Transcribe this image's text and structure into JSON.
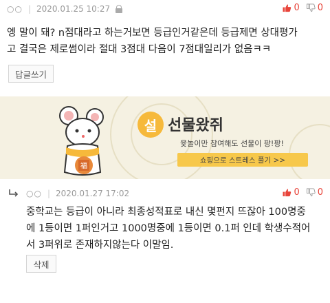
{
  "comment": {
    "author": "○○",
    "date": "2020.01.25 10:27",
    "upvotes": "0",
    "downvotes": "0",
    "text_line1": "엥 말이 돼? n점대라고 하는거보면 등급인거같은데 등급제면 상대평가",
    "text_line2": "고 결국은 제로썸이라 절대 3점대 다음이 7점대일리가 없음ㅋㅋ",
    "reply_button": "답글쓰기"
  },
  "banner": {
    "badge": "설",
    "title": "선물왔쥐",
    "subtitle": "윷놀이만 참여해도 선물이 팡!팡!",
    "cta": "쇼핑으로 스트레스 풀기 >>",
    "mouse_tag": "福"
  },
  "reply": {
    "author": "○○",
    "date": "2020.01.27 17:02",
    "upvotes": "0",
    "downvotes": "0",
    "text_line1": "중학교는 등급이 아니라 최종성적표로 내신 몇펀지 뜨잖아 100명중",
    "text_line2": "에 1등이면 1퍼인거고 1000명중에 1등이면 0.1퍼 인데 학생수적어",
    "text_line3": "서 3퍼위로 존재하지않는다 이말임.",
    "delete_button": "삭제"
  },
  "colors": {
    "accent": "#e8443a",
    "banner_bg": "#f5f1e2",
    "banner_yellow": "#f6b93b"
  }
}
